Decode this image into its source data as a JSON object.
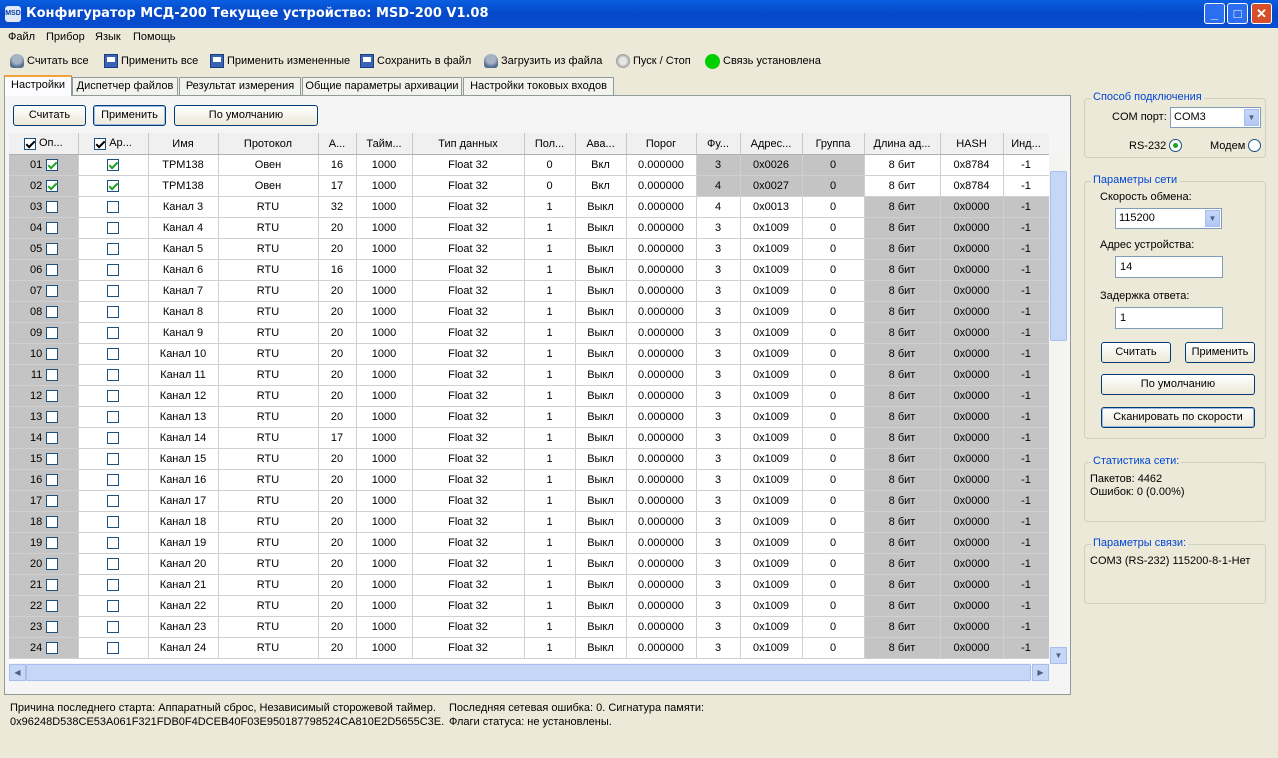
{
  "window": {
    "title": "Конфигуратор МСД-200   Текущее устройство: MSD-200 V1.08",
    "icon": "app-icon",
    "icon_text": "MSD"
  },
  "menu": [
    "Файл",
    "Прибор",
    "Язык",
    "Помощь"
  ],
  "toolbar": {
    "read_all": "Считать все",
    "apply_all": "Применить все",
    "apply_changed": "Применить измененные",
    "save_file": "Сохранить в файл",
    "load_file": "Загрузить из файла",
    "start_stop": "Пуск / Стоп",
    "connection_status": "Связь установлена",
    "status_color": "#00d000"
  },
  "tabs": [
    "Настройки",
    "Диспетчер файлов",
    "Результат измерения",
    "Общие параметры архивации",
    "Настройки токовых входов"
  ],
  "active_tab": "Настройки",
  "settings_buttons": {
    "read": "Считать",
    "apply": "Применить",
    "default": "По умолчанию"
  },
  "grid": {
    "columns": [
      "Оп...",
      "Ар...",
      "Имя",
      "Протокол",
      "А...",
      "Тайм...",
      "Тип данных",
      "Пол...",
      "Ава...",
      "Порог",
      "Фу...",
      "Адрес...",
      "Группа",
      "Длина ад...",
      "HASH",
      "Инд..."
    ],
    "rows": [
      {
        "n": "01",
        "op": true,
        "ar": true,
        "name": "ТРМ138",
        "proto": "Овен",
        "a": "16",
        "timeout": "1000",
        "type": "Float 32",
        "pol": "0",
        "ava": "Вкл",
        "thr": "0.000000",
        "fu": "3",
        "addr": "0x0026",
        "group": "0",
        "len": "8 бит",
        "hash": "0x8784",
        "ind": "-1",
        "shade": "fu"
      },
      {
        "n": "02",
        "op": true,
        "ar": true,
        "name": "ТРМ138",
        "proto": "Овен",
        "a": "17",
        "timeout": "1000",
        "type": "Float 32",
        "pol": "0",
        "ava": "Вкл",
        "thr": "0.000000",
        "fu": "4",
        "addr": "0x0027",
        "group": "0",
        "len": "8 бит",
        "hash": "0x8784",
        "ind": "-1",
        "shade": "fu"
      },
      {
        "n": "03",
        "op": false,
        "ar": false,
        "name": "Канал 3",
        "proto": "RTU",
        "a": "32",
        "timeout": "1000",
        "type": "Float 32",
        "pol": "1",
        "ava": "Выкл",
        "thr": "0.000000",
        "fu": "4",
        "addr": "0x0013",
        "group": "0",
        "len": "8 бит",
        "hash": "0x0000",
        "ind": "-1",
        "shade": "len"
      },
      {
        "n": "04",
        "op": false,
        "ar": false,
        "name": "Канал 4",
        "proto": "RTU",
        "a": "20",
        "timeout": "1000",
        "type": "Float 32",
        "pol": "1",
        "ava": "Выкл",
        "thr": "0.000000",
        "fu": "3",
        "addr": "0x1009",
        "group": "0",
        "len": "8 бит",
        "hash": "0x0000",
        "ind": "-1",
        "shade": "len"
      },
      {
        "n": "05",
        "op": false,
        "ar": false,
        "name": "Канал 5",
        "proto": "RTU",
        "a": "20",
        "timeout": "1000",
        "type": "Float 32",
        "pol": "1",
        "ava": "Выкл",
        "thr": "0.000000",
        "fu": "3",
        "addr": "0x1009",
        "group": "0",
        "len": "8 бит",
        "hash": "0x0000",
        "ind": "-1",
        "shade": "len"
      },
      {
        "n": "06",
        "op": false,
        "ar": false,
        "name": "Канал 6",
        "proto": "RTU",
        "a": "16",
        "timeout": "1000",
        "type": "Float 32",
        "pol": "1",
        "ava": "Выкл",
        "thr": "0.000000",
        "fu": "3",
        "addr": "0x1009",
        "group": "0",
        "len": "8 бит",
        "hash": "0x0000",
        "ind": "-1",
        "shade": "len"
      },
      {
        "n": "07",
        "op": false,
        "ar": false,
        "name": "Канал 7",
        "proto": "RTU",
        "a": "20",
        "timeout": "1000",
        "type": "Float 32",
        "pol": "1",
        "ava": "Выкл",
        "thr": "0.000000",
        "fu": "3",
        "addr": "0x1009",
        "group": "0",
        "len": "8 бит",
        "hash": "0x0000",
        "ind": "-1",
        "shade": "len"
      },
      {
        "n": "08",
        "op": false,
        "ar": false,
        "name": "Канал 8",
        "proto": "RTU",
        "a": "20",
        "timeout": "1000",
        "type": "Float 32",
        "pol": "1",
        "ava": "Выкл",
        "thr": "0.000000",
        "fu": "3",
        "addr": "0x1009",
        "group": "0",
        "len": "8 бит",
        "hash": "0x0000",
        "ind": "-1",
        "shade": "len"
      },
      {
        "n": "09",
        "op": false,
        "ar": false,
        "name": "Канал 9",
        "proto": "RTU",
        "a": "20",
        "timeout": "1000",
        "type": "Float 32",
        "pol": "1",
        "ava": "Выкл",
        "thr": "0.000000",
        "fu": "3",
        "addr": "0x1009",
        "group": "0",
        "len": "8 бит",
        "hash": "0x0000",
        "ind": "-1",
        "shade": "len"
      },
      {
        "n": "10",
        "op": false,
        "ar": false,
        "name": "Канал 10",
        "proto": "RTU",
        "a": "20",
        "timeout": "1000",
        "type": "Float 32",
        "pol": "1",
        "ava": "Выкл",
        "thr": "0.000000",
        "fu": "3",
        "addr": "0x1009",
        "group": "0",
        "len": "8 бит",
        "hash": "0x0000",
        "ind": "-1",
        "shade": "len"
      },
      {
        "n": "11",
        "op": false,
        "ar": false,
        "name": "Канал 11",
        "proto": "RTU",
        "a": "20",
        "timeout": "1000",
        "type": "Float 32",
        "pol": "1",
        "ava": "Выкл",
        "thr": "0.000000",
        "fu": "3",
        "addr": "0x1009",
        "group": "0",
        "len": "8 бит",
        "hash": "0x0000",
        "ind": "-1",
        "shade": "len"
      },
      {
        "n": "12",
        "op": false,
        "ar": false,
        "name": "Канал 12",
        "proto": "RTU",
        "a": "20",
        "timeout": "1000",
        "type": "Float 32",
        "pol": "1",
        "ava": "Выкл",
        "thr": "0.000000",
        "fu": "3",
        "addr": "0x1009",
        "group": "0",
        "len": "8 бит",
        "hash": "0x0000",
        "ind": "-1",
        "shade": "len"
      },
      {
        "n": "13",
        "op": false,
        "ar": false,
        "name": "Канал 13",
        "proto": "RTU",
        "a": "20",
        "timeout": "1000",
        "type": "Float 32",
        "pol": "1",
        "ava": "Выкл",
        "thr": "0.000000",
        "fu": "3",
        "addr": "0x1009",
        "group": "0",
        "len": "8 бит",
        "hash": "0x0000",
        "ind": "-1",
        "shade": "len"
      },
      {
        "n": "14",
        "op": false,
        "ar": false,
        "name": "Канал 14",
        "proto": "RTU",
        "a": "17",
        "timeout": "1000",
        "type": "Float 32",
        "pol": "1",
        "ava": "Выкл",
        "thr": "0.000000",
        "fu": "3",
        "addr": "0x1009",
        "group": "0",
        "len": "8 бит",
        "hash": "0x0000",
        "ind": "-1",
        "shade": "len"
      },
      {
        "n": "15",
        "op": false,
        "ar": false,
        "name": "Канал 15",
        "proto": "RTU",
        "a": "20",
        "timeout": "1000",
        "type": "Float 32",
        "pol": "1",
        "ava": "Выкл",
        "thr": "0.000000",
        "fu": "3",
        "addr": "0x1009",
        "group": "0",
        "len": "8 бит",
        "hash": "0x0000",
        "ind": "-1",
        "shade": "len"
      },
      {
        "n": "16",
        "op": false,
        "ar": false,
        "name": "Канал 16",
        "proto": "RTU",
        "a": "20",
        "timeout": "1000",
        "type": "Float 32",
        "pol": "1",
        "ava": "Выкл",
        "thr": "0.000000",
        "fu": "3",
        "addr": "0x1009",
        "group": "0",
        "len": "8 бит",
        "hash": "0x0000",
        "ind": "-1",
        "shade": "len"
      },
      {
        "n": "17",
        "op": false,
        "ar": false,
        "name": "Канал 17",
        "proto": "RTU",
        "a": "20",
        "timeout": "1000",
        "type": "Float 32",
        "pol": "1",
        "ava": "Выкл",
        "thr": "0.000000",
        "fu": "3",
        "addr": "0x1009",
        "group": "0",
        "len": "8 бит",
        "hash": "0x0000",
        "ind": "-1",
        "shade": "len"
      },
      {
        "n": "18",
        "op": false,
        "ar": false,
        "name": "Канал 18",
        "proto": "RTU",
        "a": "20",
        "timeout": "1000",
        "type": "Float 32",
        "pol": "1",
        "ava": "Выкл",
        "thr": "0.000000",
        "fu": "3",
        "addr": "0x1009",
        "group": "0",
        "len": "8 бит",
        "hash": "0x0000",
        "ind": "-1",
        "shade": "len"
      },
      {
        "n": "19",
        "op": false,
        "ar": false,
        "name": "Канал 19",
        "proto": "RTU",
        "a": "20",
        "timeout": "1000",
        "type": "Float 32",
        "pol": "1",
        "ava": "Выкл",
        "thr": "0.000000",
        "fu": "3",
        "addr": "0x1009",
        "group": "0",
        "len": "8 бит",
        "hash": "0x0000",
        "ind": "-1",
        "shade": "len"
      },
      {
        "n": "20",
        "op": false,
        "ar": false,
        "name": "Канал 20",
        "proto": "RTU",
        "a": "20",
        "timeout": "1000",
        "type": "Float 32",
        "pol": "1",
        "ava": "Выкл",
        "thr": "0.000000",
        "fu": "3",
        "addr": "0x1009",
        "group": "0",
        "len": "8 бит",
        "hash": "0x0000",
        "ind": "-1",
        "shade": "len"
      },
      {
        "n": "21",
        "op": false,
        "ar": false,
        "name": "Канал 21",
        "proto": "RTU",
        "a": "20",
        "timeout": "1000",
        "type": "Float 32",
        "pol": "1",
        "ava": "Выкл",
        "thr": "0.000000",
        "fu": "3",
        "addr": "0x1009",
        "group": "0",
        "len": "8 бит",
        "hash": "0x0000",
        "ind": "-1",
        "shade": "len"
      },
      {
        "n": "22",
        "op": false,
        "ar": false,
        "name": "Канал 22",
        "proto": "RTU",
        "a": "20",
        "timeout": "1000",
        "type": "Float 32",
        "pol": "1",
        "ava": "Выкл",
        "thr": "0.000000",
        "fu": "3",
        "addr": "0x1009",
        "group": "0",
        "len": "8 бит",
        "hash": "0x0000",
        "ind": "-1",
        "shade": "len"
      },
      {
        "n": "23",
        "op": false,
        "ar": false,
        "name": "Канал 23",
        "proto": "RTU",
        "a": "20",
        "timeout": "1000",
        "type": "Float 32",
        "pol": "1",
        "ava": "Выкл",
        "thr": "0.000000",
        "fu": "3",
        "addr": "0x1009",
        "group": "0",
        "len": "8 бит",
        "hash": "0x0000",
        "ind": "-1",
        "shade": "len"
      },
      {
        "n": "24",
        "op": false,
        "ar": false,
        "name": "Канал 24",
        "proto": "RTU",
        "a": "20",
        "timeout": "1000",
        "type": "Float 32",
        "pol": "1",
        "ava": "Выкл",
        "thr": "0.000000",
        "fu": "3",
        "addr": "0x1009",
        "group": "0",
        "len": "8 бит",
        "hash": "0x0000",
        "ind": "-1",
        "shade": "len"
      }
    ]
  },
  "bottom_info": {
    "line1a": "Причина последнего старта: Аппаратный сброс, Независимый сторожевой таймер.",
    "line1b": "Последняя сетевая ошибка: 0. Сигнатура памяти:",
    "line2a": "0x96248D538CE53A061F321FDB0F4DCEB40F03E950187798524CA810E2D5655C3E.",
    "line2b": "Флаги статуса: не установлены."
  },
  "connection": {
    "title": "Способ подключения",
    "com_label": "COM порт:",
    "com_value": "COM3",
    "rs232": "RS-232",
    "modem": "Модем",
    "selected": "RS-232"
  },
  "network": {
    "title": "Параметры сети",
    "speed_label": "Скорость обмена:",
    "speed_value": "115200",
    "addr_label": "Адрес устройства:",
    "addr_value": "14",
    "delay_label": "Задержка ответа:",
    "delay_value": "1",
    "read": "Считать",
    "apply": "Применить",
    "default": "По умолчанию",
    "scan": "Сканировать по скорости"
  },
  "stats": {
    "title": "Статистика сети:",
    "packets": "Пакетов: 4462",
    "errors": "Ошибок: 0 (0.00%)"
  },
  "link": {
    "title": "Параметры связи:",
    "value": "COM3 (RS-232)  115200-8-1-Нет"
  }
}
